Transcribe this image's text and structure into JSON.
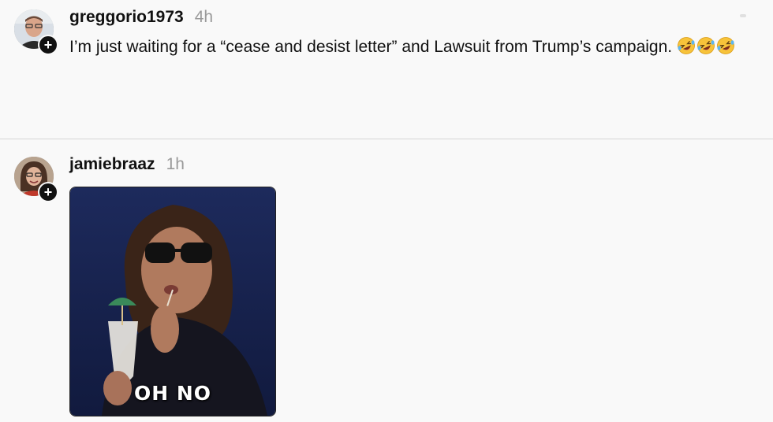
{
  "posts": [
    {
      "username": "greggorio1973",
      "time": "4h",
      "text": "I’m just waiting for a “cease and desist letter” and Lawsuit from Trump’s campaign.",
      "emoji_name": "rolling-on-floor-laughing",
      "emoji_count": 3
    },
    {
      "username": "jamiebraaz",
      "time": "1h",
      "gif_caption": "OH NO"
    }
  ],
  "follow_symbol": "+"
}
